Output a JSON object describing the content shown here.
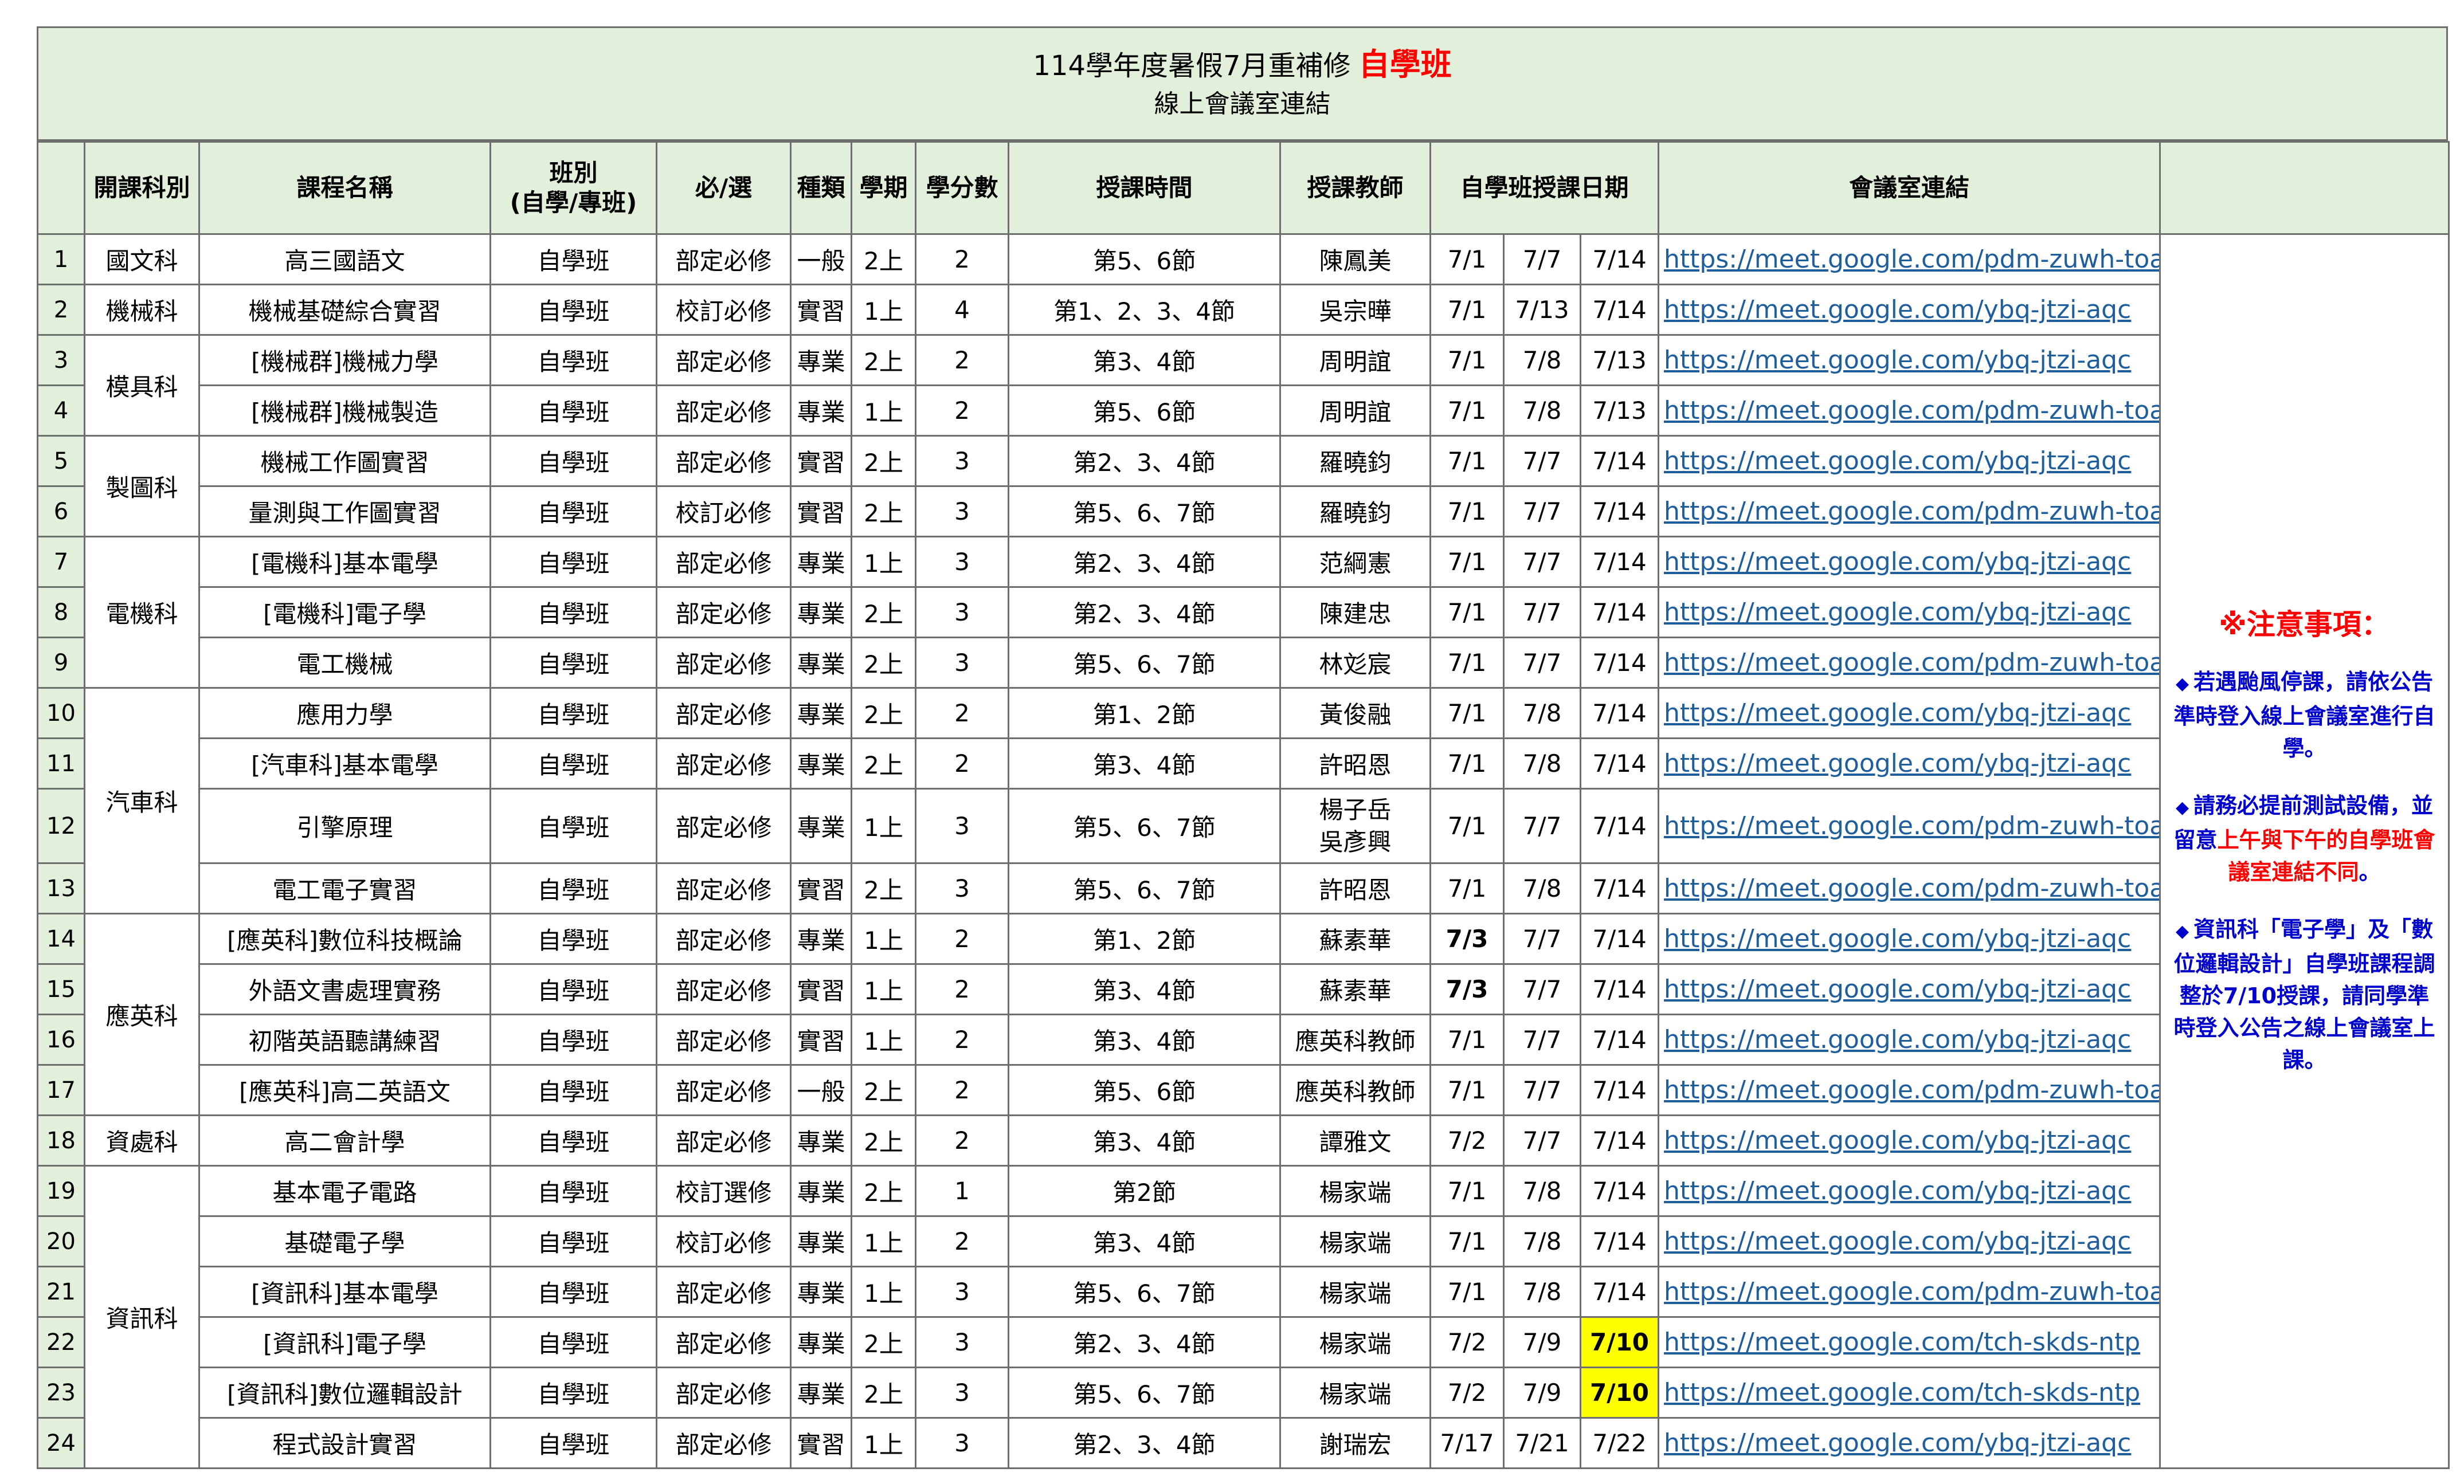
{
  "title": {
    "line1_prefix": "114學年度暑假7月重補修",
    "line1_highlight": "自學班",
    "line2": "線上會議室連結",
    "highlight_color": "#ff0000"
  },
  "headers": {
    "num": "",
    "dept": "開課科別",
    "course": "課程名稱",
    "class_type_line1": "班別",
    "class_type_line2": "(自學/專班)",
    "required": "必/選",
    "category": "種類",
    "semester": "學期",
    "credits": "學分數",
    "time": "授課時間",
    "teacher": "授課教師",
    "dates": "自學班授課日期",
    "link": "會議室連結",
    "notes": ""
  },
  "rows": [
    {
      "num": "1",
      "dept": "國文科",
      "course": "高三國語文",
      "type": "自學班",
      "req": "部定必修",
      "cat": "一般",
      "sem": "2上",
      "cr": "2",
      "time": "第5、6節",
      "teacher": "陳鳳美",
      "d1": "7/1",
      "d2": "7/7",
      "d3": "7/14",
      "link": "https://meet.google.com/pdm-zuwh-toa"
    },
    {
      "num": "2",
      "dept": "機械科",
      "course": "機械基礎綜合實習",
      "type": "自學班",
      "req": "校訂必修",
      "cat": "實習",
      "sem": "1上",
      "cr": "4",
      "time": "第1、2、3、4節",
      "teacher": "吳宗曄",
      "d1": "7/1",
      "d2": "7/13",
      "d3": "7/14",
      "link": "https://meet.google.com/ybq-jtzi-aqc"
    },
    {
      "num": "3",
      "dept": "模具科",
      "course": "[機械群]機械力學",
      "type": "自學班",
      "req": "部定必修",
      "cat": "專業",
      "sem": "2上",
      "cr": "2",
      "time": "第3、4節",
      "teacher": "周明誼",
      "d1": "7/1",
      "d2": "7/8",
      "d3": "7/13",
      "link": "https://meet.google.com/ybq-jtzi-aqc"
    },
    {
      "num": "4",
      "dept": "",
      "course": "[機械群]機械製造",
      "type": "自學班",
      "req": "部定必修",
      "cat": "專業",
      "sem": "1上",
      "cr": "2",
      "time": "第5、6節",
      "teacher": "周明誼",
      "d1": "7/1",
      "d2": "7/8",
      "d3": "7/13",
      "link": "https://meet.google.com/pdm-zuwh-toa"
    },
    {
      "num": "5",
      "dept": "製圖科",
      "course": "機械工作圖實習",
      "type": "自學班",
      "req": "部定必修",
      "cat": "實習",
      "sem": "2上",
      "cr": "3",
      "time": "第2、3、4節",
      "teacher": "羅曉鈞",
      "d1": "7/1",
      "d2": "7/7",
      "d3": "7/14",
      "link": "https://meet.google.com/ybq-jtzi-aqc"
    },
    {
      "num": "6",
      "dept": "",
      "course": "量測與工作圖實習",
      "type": "自學班",
      "req": "校訂必修",
      "cat": "實習",
      "sem": "2上",
      "cr": "3",
      "time": "第5、6、7節",
      "teacher": "羅曉鈞",
      "d1": "7/1",
      "d2": "7/7",
      "d3": "7/14",
      "link": "https://meet.google.com/pdm-zuwh-toa"
    },
    {
      "num": "7",
      "dept": "電機科",
      "course": "[電機科]基本電學",
      "type": "自學班",
      "req": "部定必修",
      "cat": "專業",
      "sem": "1上",
      "cr": "3",
      "time": "第2、3、4節",
      "teacher": "范綱憲",
      "d1": "7/1",
      "d2": "7/7",
      "d3": "7/14",
      "link": "https://meet.google.com/ybq-jtzi-aqc"
    },
    {
      "num": "8",
      "dept": "",
      "course": "[電機科]電子學",
      "type": "自學班",
      "req": "部定必修",
      "cat": "專業",
      "sem": "2上",
      "cr": "3",
      "time": "第2、3、4節",
      "teacher": "陳建忠",
      "d1": "7/1",
      "d2": "7/7",
      "d3": "7/14",
      "link": "https://meet.google.com/ybq-jtzi-aqc"
    },
    {
      "num": "9",
      "dept": "",
      "course": "電工機械",
      "type": "自學班",
      "req": "部定必修",
      "cat": "專業",
      "sem": "2上",
      "cr": "3",
      "time": "第5、6、7節",
      "teacher": "林彣宸",
      "d1": "7/1",
      "d2": "7/7",
      "d3": "7/14",
      "link": "https://meet.google.com/pdm-zuwh-toa"
    },
    {
      "num": "10",
      "dept": "汽車科",
      "course": "應用力學",
      "type": "自學班",
      "req": "部定必修",
      "cat": "專業",
      "sem": "2上",
      "cr": "2",
      "time": "第1、2節",
      "teacher": "黃俊融",
      "d1": "7/1",
      "d2": "7/8",
      "d3": "7/14",
      "link": "https://meet.google.com/ybq-jtzi-aqc"
    },
    {
      "num": "11",
      "dept": "",
      "course": "[汽車科]基本電學",
      "type": "自學班",
      "req": "部定必修",
      "cat": "專業",
      "sem": "2上",
      "cr": "2",
      "time": "第3、4節",
      "teacher": "許昭恩",
      "d1": "7/1",
      "d2": "7/8",
      "d3": "7/14",
      "link": "https://meet.google.com/ybq-jtzi-aqc"
    },
    {
      "num": "12",
      "dept": "",
      "course": "引擎原理",
      "type": "自學班",
      "req": "部定必修",
      "cat": "專業",
      "sem": "1上",
      "cr": "3",
      "time": "第5、6、7節",
      "teacher": "楊子岳",
      "teacher2": "吳彥興",
      "d1": "7/1",
      "d2": "7/7",
      "d3": "7/14",
      "link": "https://meet.google.com/pdm-zuwh-toa"
    },
    {
      "num": "13",
      "dept": "",
      "course": "電工電子實習",
      "type": "自學班",
      "req": "部定必修",
      "cat": "實習",
      "sem": "2上",
      "cr": "3",
      "time": "第5、6、7節",
      "teacher": "許昭恩",
      "d1": "7/1",
      "d2": "7/8",
      "d3": "7/14",
      "link": "https://meet.google.com/pdm-zuwh-toa"
    },
    {
      "num": "14",
      "dept": "應英科",
      "course": "[應英科]數位科技概論",
      "type": "自學班",
      "req": "部定必修",
      "cat": "專業",
      "sem": "1上",
      "cr": "2",
      "time": "第1、2節",
      "teacher": "蘇素華",
      "d1": "7/3",
      "d2": "7/7",
      "d3": "7/14",
      "link": "https://meet.google.com/ybq-jtzi-aqc"
    },
    {
      "num": "15",
      "dept": "",
      "course": "外語文書處理實務",
      "type": "自學班",
      "req": "部定必修",
      "cat": "實習",
      "sem": "1上",
      "cr": "2",
      "time": "第3、4節",
      "teacher": "蘇素華",
      "d1": "7/3",
      "d2": "7/7",
      "d3": "7/14",
      "link": "https://meet.google.com/ybq-jtzi-aqc"
    },
    {
      "num": "16",
      "dept": "",
      "course": "初階英語聽講練習",
      "type": "自學班",
      "req": "部定必修",
      "cat": "實習",
      "sem": "1上",
      "cr": "2",
      "time": "第3、4節",
      "teacher": "應英科教師",
      "d1": "7/1",
      "d2": "7/7",
      "d3": "7/14",
      "link": "https://meet.google.com/ybq-jtzi-aqc"
    },
    {
      "num": "17",
      "dept": "",
      "course": "[應英科]高二英語文",
      "type": "自學班",
      "req": "部定必修",
      "cat": "一般",
      "sem": "2上",
      "cr": "2",
      "time": "第5、6節",
      "teacher": "應英科教師",
      "d1": "7/1",
      "d2": "7/7",
      "d3": "7/14",
      "link": "https://meet.google.com/pdm-zuwh-toa"
    },
    {
      "num": "18",
      "dept": "資處科",
      "course": "高二會計學",
      "type": "自學班",
      "req": "部定必修",
      "cat": "專業",
      "sem": "2上",
      "cr": "2",
      "time": "第3、4節",
      "teacher": "譚雅文",
      "d1": "7/2",
      "d2": "7/7",
      "d3": "7/14",
      "link": "https://meet.google.com/ybq-jtzi-aqc"
    },
    {
      "num": "19",
      "dept": "資訊科",
      "course": "基本電子電路",
      "type": "自學班",
      "req": "校訂選修",
      "cat": "專業",
      "sem": "2上",
      "cr": "1",
      "time": "第2節",
      "teacher": "楊家端",
      "d1": "7/1",
      "d2": "7/8",
      "d3": "7/14",
      "link": "https://meet.google.com/ybq-jtzi-aqc"
    },
    {
      "num": "20",
      "dept": "",
      "course": "基礎電子學",
      "type": "自學班",
      "req": "校訂必修",
      "cat": "專業",
      "sem": "1上",
      "cr": "2",
      "time": "第3、4節",
      "teacher": "楊家端",
      "d1": "7/1",
      "d2": "7/8",
      "d3": "7/14",
      "link": "https://meet.google.com/ybq-jtzi-aqc"
    },
    {
      "num": "21",
      "dept": "",
      "course": "[資訊科]基本電學",
      "type": "自學班",
      "req": "部定必修",
      "cat": "專業",
      "sem": "1上",
      "cr": "3",
      "time": "第5、6、7節",
      "teacher": "楊家端",
      "d1": "7/1",
      "d2": "7/8",
      "d3": "7/14",
      "link": "https://meet.google.com/pdm-zuwh-toa"
    },
    {
      "num": "22",
      "dept": "",
      "course": "[資訊科]電子學",
      "type": "自學班",
      "req": "部定必修",
      "cat": "專業",
      "sem": "2上",
      "cr": "3",
      "time": "第2、3、4節",
      "teacher": "楊家端",
      "d1": "7/2",
      "d2": "7/9",
      "d3": "7/10",
      "link": "https://meet.google.com/tch-skds-ntp"
    },
    {
      "num": "23",
      "dept": "",
      "course": "[資訊科]數位邏輯設計",
      "type": "自學班",
      "req": "部定必修",
      "cat": "專業",
      "sem": "2上",
      "cr": "3",
      "time": "第5、6、7節",
      "teacher": "楊家端",
      "d1": "7/2",
      "d2": "7/9",
      "d3": "7/10",
      "link": "https://meet.google.com/tch-skds-ntp"
    },
    {
      "num": "24",
      "dept": "",
      "course": "程式設計實習",
      "type": "自學班",
      "req": "部定必修",
      "cat": "實習",
      "sem": "1上",
      "cr": "3",
      "time": "第2、3、4節",
      "teacher": "謝瑞宏",
      "d1": "7/17",
      "d2": "7/21",
      "d3": "7/22",
      "link": "https://meet.google.com/ybq-jtzi-aqc"
    }
  ],
  "notes": {
    "heading": "※注意事項：",
    "item1": "若遇颱風停課，請依公告準時登入線上會議室進行自學。",
    "item2_a": "請務必提前測試設備，並留意",
    "item2_red": "上午與下午的自學班會議室連結不同",
    "item2_b": "。",
    "item3": "資訊科「電子學」及「數位邏輯設計」自學班課程調整於7/10授課，請同學準時登入公告之線上會議室上課。",
    "bullet": "◆"
  },
  "colors": {
    "header_bg": "#e2efda",
    "link": "#1f5e9c",
    "highlight": "#ffff00",
    "note_blue": "#0000cc",
    "note_red": "#ff0000"
  }
}
